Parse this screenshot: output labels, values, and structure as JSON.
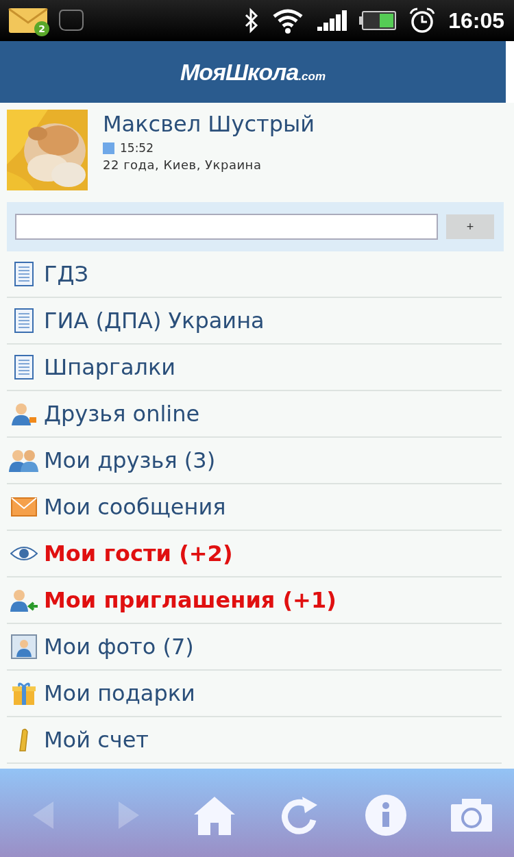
{
  "status_bar": {
    "notification_count": "2",
    "time": "16:05"
  },
  "header": {
    "logo": "МояШкола",
    "logo_suffix": ".com"
  },
  "profile": {
    "name": "Максвел Шустрый",
    "online_time": "15:52",
    "info": "22 года, Киев, Украина"
  },
  "status_form": {
    "add_button": "+"
  },
  "menu": [
    {
      "kind": "document",
      "label": "ГДЗ",
      "alert": false
    },
    {
      "kind": "document",
      "label": "ГИА (ДПА) Украина",
      "alert": false
    },
    {
      "kind": "document",
      "label": "Шпаргалки",
      "alert": false
    },
    {
      "kind": "online",
      "label": "Друзья online",
      "alert": false
    },
    {
      "kind": "friends",
      "label": "Мои друзья (3)",
      "alert": false
    },
    {
      "kind": "mail",
      "label": "Мои сообщения",
      "alert": false
    },
    {
      "kind": "eye",
      "label": "Мои гости (+2)",
      "alert": true
    },
    {
      "kind": "invite",
      "label": "Мои приглашения (+1)",
      "alert": true
    },
    {
      "label": "Мои фото (7)",
      "alert": false
    },
    {
      "kind": "gift",
      "label": "Мои подарки",
      "alert": false
    },
    {
      "kind": "coin",
      "label": "Мой счет",
      "alert": false
    }
  ],
  "toolbar": [
    {
      "kind": "back",
      "disabled": true
    },
    {
      "kind": "forward",
      "disabled": true
    },
    {
      "kind": "home",
      "disabled": false
    },
    {
      "kind": "refresh",
      "disabled": false
    },
    {
      "kind": "info",
      "disabled": false
    },
    {
      "kind": "camera",
      "disabled": false
    }
  ]
}
